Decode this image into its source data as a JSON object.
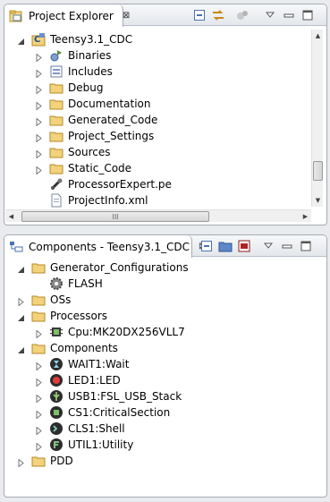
{
  "project_explorer": {
    "tab_label": "Project Explorer",
    "close_glyph": "⊠",
    "toolbar": [
      "collapse-all-icon",
      "link-with-editor-icon",
      "filter-icon",
      "view-menu-icon",
      "minimize-icon",
      "maximize-icon"
    ],
    "root": {
      "label": "Teensy3.1_CDC",
      "icon": "project-icon"
    },
    "items": [
      {
        "label": "Binaries",
        "icon": "binaries-icon"
      },
      {
        "label": "Includes",
        "icon": "includes-icon"
      },
      {
        "label": "Debug",
        "icon": "folder-icon"
      },
      {
        "label": "Documentation",
        "icon": "folder-icon"
      },
      {
        "label": "Generated_Code",
        "icon": "folder-icon"
      },
      {
        "label": "Project_Settings",
        "icon": "folder-icon"
      },
      {
        "label": "Sources",
        "icon": "folder-icon"
      },
      {
        "label": "Static_Code",
        "icon": "folder-icon"
      },
      {
        "label": "ProcessorExpert.pe",
        "icon": "pe-file-icon"
      },
      {
        "label": "ProjectInfo.xml",
        "icon": "xml-file-icon"
      }
    ],
    "hscroll_grip": "III"
  },
  "components": {
    "tab_label": "Components - Teensy3.1_CDC",
    "close_glyph": "⊠",
    "toolbar": [
      "collapse-all-icon",
      "open-folder-icon",
      "export-icon",
      "view-menu-icon",
      "minimize-icon",
      "maximize-icon"
    ],
    "groups": [
      {
        "label": "Generator_Configurations",
        "expanded": true,
        "children": [
          {
            "label": "FLASH",
            "icon": "gear-icon"
          }
        ]
      },
      {
        "label": "OSs",
        "expanded": false,
        "children": []
      },
      {
        "label": "Processors",
        "expanded": true,
        "children": [
          {
            "label": "Cpu:MK20DX256VLL7",
            "icon": "chip-icon"
          }
        ]
      },
      {
        "label": "Components",
        "expanded": true,
        "children": [
          {
            "label": "WAIT1:Wait",
            "icon": "wait-icon"
          },
          {
            "label": "LED1:LED",
            "icon": "led-icon"
          },
          {
            "label": "USB1:FSL_USB_Stack",
            "icon": "usb-icon"
          },
          {
            "label": "CS1:CriticalSection",
            "icon": "chip-icon"
          },
          {
            "label": "CLS1:Shell",
            "icon": "shell-icon"
          },
          {
            "label": "UTIL1:Utility",
            "icon": "utility-icon"
          }
        ]
      },
      {
        "label": "PDD",
        "expanded": false,
        "children": []
      }
    ]
  }
}
